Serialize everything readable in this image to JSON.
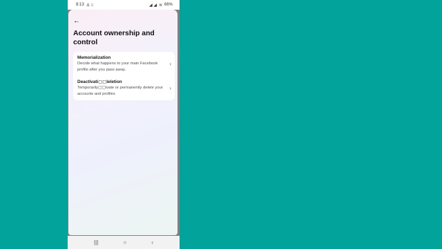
{
  "status_bar": {
    "time": "8:13",
    "left_icons": "⚓ ⁝⁝",
    "signal": "◢ ◢",
    "wifi": "≋",
    "battery": "66%"
  },
  "page": {
    "back": "←",
    "title": "Account ownership and control"
  },
  "items": [
    {
      "title": "Memorialization",
      "description": "Decide what happens to your main Facebook profile after you pass away."
    },
    {
      "title": "Deactivati▢▢leletion",
      "description": "Temporarily▢▢ivate or permanently delete your accounts and profiles"
    }
  ],
  "chevron": "›",
  "nav": {
    "recents": "|||",
    "home": "○",
    "back": "‹"
  }
}
